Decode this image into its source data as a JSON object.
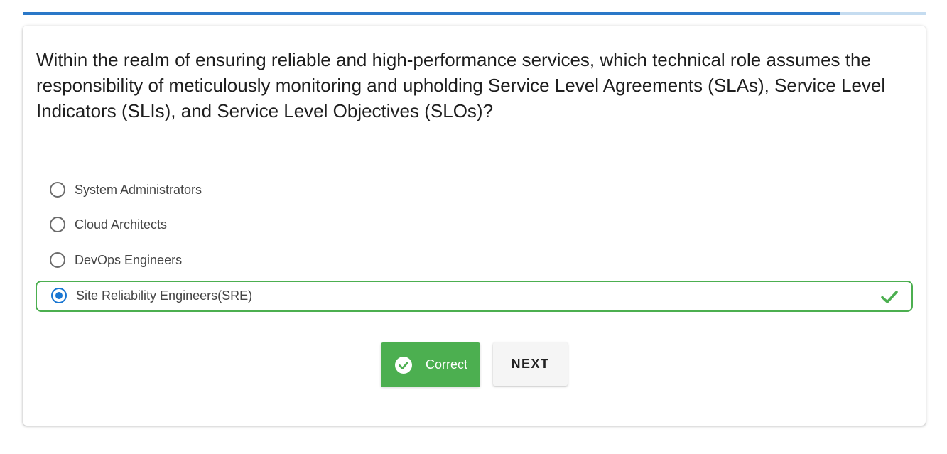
{
  "progress": {
    "fraction": 0.905,
    "fill_color": "#2a78c8",
    "track_color": "#c5dcf0"
  },
  "question": {
    "text": "Within the realm of ensuring reliable and high-performance services, which technical role assumes the responsibility of meticulously monitoring and upholding Service Level Agreements (SLAs), Service Level Indicators (SLIs), and Service Level Objectives (SLOs)?"
  },
  "options": [
    {
      "label": "System Administrators",
      "selected": false
    },
    {
      "label": "Cloud Architects",
      "selected": false
    },
    {
      "label": "DevOps Engineers",
      "selected": false
    },
    {
      "label": "Site Reliability Engineers(SRE)",
      "selected": true,
      "status_icon": "check-icon"
    }
  ],
  "feedback_button": {
    "label": "Correct",
    "icon": "check-circle-icon",
    "color": "#4caf50"
  },
  "next_button": {
    "label": "NEXT"
  }
}
